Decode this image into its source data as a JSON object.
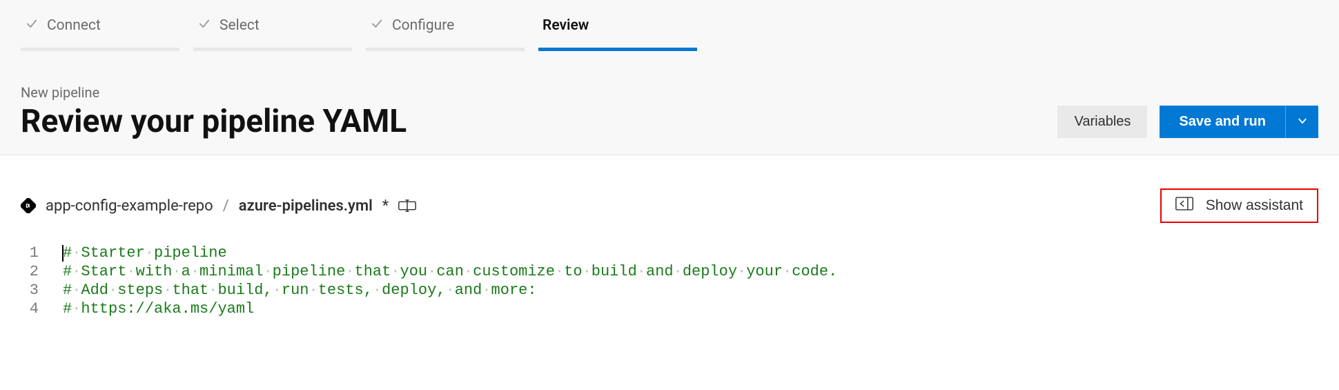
{
  "wizard": {
    "steps": [
      {
        "label": "Connect",
        "done": true,
        "active": false
      },
      {
        "label": "Select",
        "done": true,
        "active": false
      },
      {
        "label": "Configure",
        "done": true,
        "active": false
      },
      {
        "label": "Review",
        "done": false,
        "active": true
      }
    ]
  },
  "header": {
    "eyebrow": "New pipeline",
    "title": "Review your pipeline YAML",
    "variables_label": "Variables",
    "save_run_label": "Save and run"
  },
  "file": {
    "repo_name": "app-config-example-repo",
    "separator": "/",
    "file_name": "azure-pipelines.yml",
    "dirty_mark": "*",
    "show_assistant_label": "Show assistant"
  },
  "editor": {
    "lines": [
      {
        "num": "1",
        "text": "# Starter pipeline"
      },
      {
        "num": "2",
        "text": "# Start with a minimal pipeline that you can customize to build and deploy your code."
      },
      {
        "num": "3",
        "text": "# Add steps that build, run tests, deploy, and more:"
      },
      {
        "num": "4",
        "text": "# https://aka.ms/yaml"
      }
    ]
  }
}
